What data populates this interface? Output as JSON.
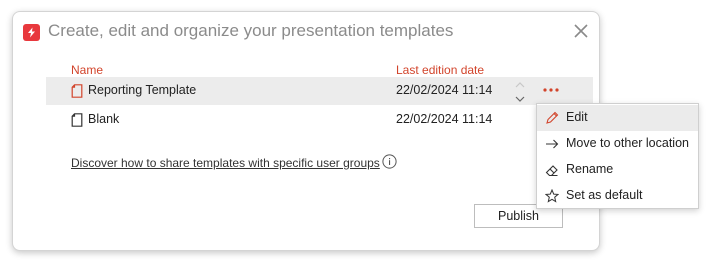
{
  "dialog": {
    "title": "Create, edit and organize your presentation templates"
  },
  "table": {
    "headers": {
      "name": "Name",
      "date": "Last edition date"
    },
    "rows": [
      {
        "name": "Reporting Template",
        "date": "22/02/2024 11:14",
        "selected": true
      },
      {
        "name": "Blank",
        "date": "22/02/2024 11:14",
        "selected": false
      }
    ]
  },
  "share_link": "Discover how to share templates with specific user groups",
  "publish_label": "Publish",
  "context_menu": {
    "items": [
      {
        "label": "Edit",
        "icon": "pencil-icon"
      },
      {
        "label": "Move to other location",
        "icon": "arrow-right-icon"
      },
      {
        "label": "Rename",
        "icon": "eraser-icon"
      },
      {
        "label": "Set as default",
        "icon": "star-icon"
      }
    ]
  },
  "colors": {
    "accent": "#d2442b",
    "brand": "#e8383d",
    "selected_row": "#ececec"
  }
}
